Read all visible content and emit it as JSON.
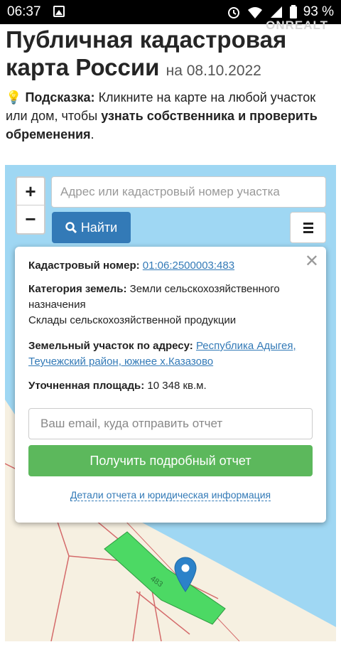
{
  "status_bar": {
    "time": "06:37",
    "battery": "93 %"
  },
  "watermark": "ONREALT",
  "header": {
    "title": "Публичная кадастровая карта России",
    "date": "на 08.10.2022"
  },
  "hint": {
    "label": "Подсказка:",
    "text1": "Кликните на карте на любой участок или дом, чтобы",
    "bold": "узнать собственника и проверить обременения",
    "end": "."
  },
  "map_controls": {
    "zoom_in": "+",
    "zoom_out": "−",
    "search_placeholder": "Адрес или кадастровый номер участка",
    "find_label": "Найти"
  },
  "popup": {
    "cad_label": "Кадастровый номер:",
    "cad_value": "01:06:2500003:483",
    "cat_label": "Категория земель:",
    "cat_value": "Земли сельскохозяйственного назначения",
    "usage": "Склады сельскохозяйственной продукции",
    "addr_label": "Земельный участок по адресу:",
    "addr_value": "Республика Адыгея, Теучежский район, южнее х.Казазово",
    "area_label": "Уточненная площадь:",
    "area_value": "10 348 кв.м.",
    "email_placeholder": "Ваш email, куда отправить отчет",
    "get_report": "Получить подробный отчет",
    "details_link": "Детали отчета и юридическая информация"
  },
  "parcel_label": "483",
  "colors": {
    "water": "#9fd7f3",
    "land": "#f6f0e1",
    "parcel": "#4cd964",
    "primary": "#337ab7",
    "success": "#5cb85c"
  }
}
